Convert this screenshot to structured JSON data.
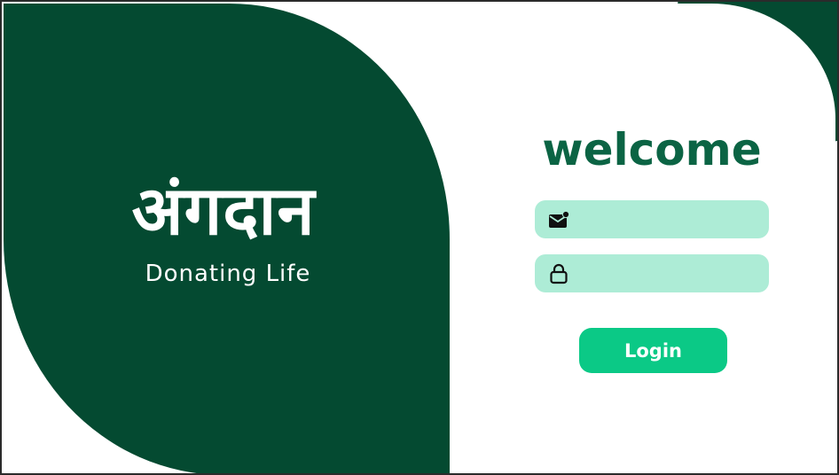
{
  "brand": {
    "name": "अंगदान",
    "tagline": "Donating Life"
  },
  "login": {
    "heading": "welcome",
    "email_field": {
      "icon": "mail-icon",
      "value": ""
    },
    "password_field": {
      "icon": "lock-icon",
      "value": ""
    },
    "submit_label": "Login"
  },
  "colors": {
    "brand_green": "#044a31",
    "heading_green": "#0b6444",
    "field_bg": "#adecd6",
    "button_green": "#0bc986"
  }
}
